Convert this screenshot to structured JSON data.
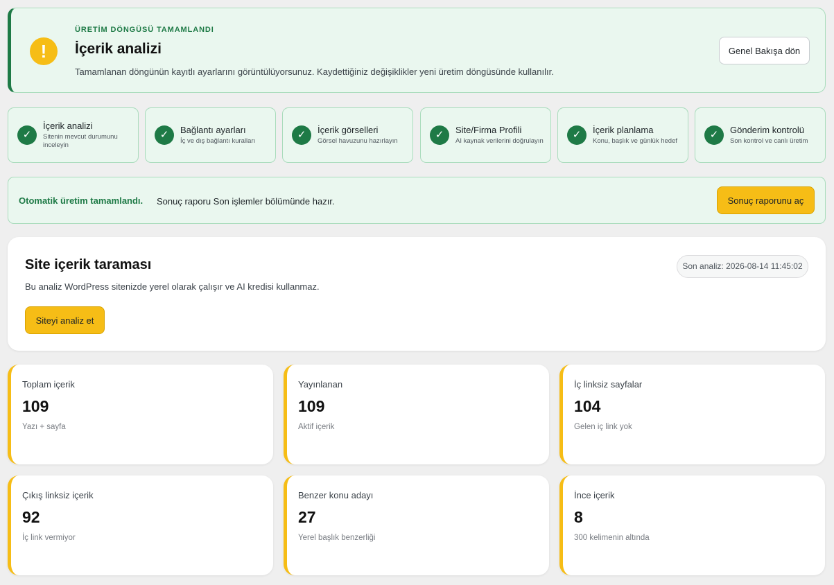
{
  "banner": {
    "eyebrow": "ÜRETİM DÖNGÜSÜ TAMAMLANDI",
    "title": "İçerik analizi",
    "description": "Tamamlanan döngünün kayıtlı ayarlarını görüntülüyorsunuz. Kaydettiğiniz değişiklikler yeni üretim döngüsünde kullanılır.",
    "back_button": "Genel Bakışa dön",
    "icon": "exclamation-icon",
    "icon_glyph": "!"
  },
  "steps": [
    {
      "title": "İçerik analizi",
      "subtitle": "Sitenin mevcut durumunu inceleyin",
      "status": "done"
    },
    {
      "title": "Bağlantı ayarları",
      "subtitle": "İç ve dış bağlantı kuralları",
      "status": "done"
    },
    {
      "title": "İçerik görselleri",
      "subtitle": "Görsel havuzunu hazırlayın",
      "status": "done"
    },
    {
      "title": "Site/Firma Profili",
      "subtitle": "AI kaynak verilerini doğrulayın",
      "status": "done"
    },
    {
      "title": "İçerik planlama",
      "subtitle": "Konu, başlık ve günlük hedef",
      "status": "done"
    },
    {
      "title": "Gönderim kontrolü",
      "subtitle": "Son kontrol ve canlı üretim",
      "status": "done"
    }
  ],
  "check_glyph": "✓",
  "notice": {
    "strong": "Otomatik üretim tamamlandı.",
    "text": "Sonuç raporu Son işlemler bölümünde hazır.",
    "button": "Sonuç raporunu aç"
  },
  "scan": {
    "title": "Site içerik taraması",
    "description": "Bu analiz WordPress sitenizde yerel olarak çalışır ve AI kredisi kullanmaz.",
    "last_analysis": "Son analiz: 2026-08-14 11:45:02",
    "button": "Siteyi analiz et"
  },
  "stats": [
    {
      "label": "Toplam içerik",
      "value": "109",
      "sub": "Yazı + sayfa"
    },
    {
      "label": "Yayınlanan",
      "value": "109",
      "sub": "Aktif içerik"
    },
    {
      "label": "İç linksiz sayfalar",
      "value": "104",
      "sub": "Gelen iç link yok"
    },
    {
      "label": "Çıkış linksiz içerik",
      "value": "92",
      "sub": "İç link vermiyor"
    },
    {
      "label": "Benzer konu adayı",
      "value": "27",
      "sub": "Yerel başlık benzerliği"
    },
    {
      "label": "İnce içerik",
      "value": "8",
      "sub": "300 kelimenin altında"
    }
  ],
  "colors": {
    "success": "#1e7a46",
    "success_bg": "#eaf7ef",
    "accent": "#f6bd16",
    "page_bg": "#efefef"
  }
}
